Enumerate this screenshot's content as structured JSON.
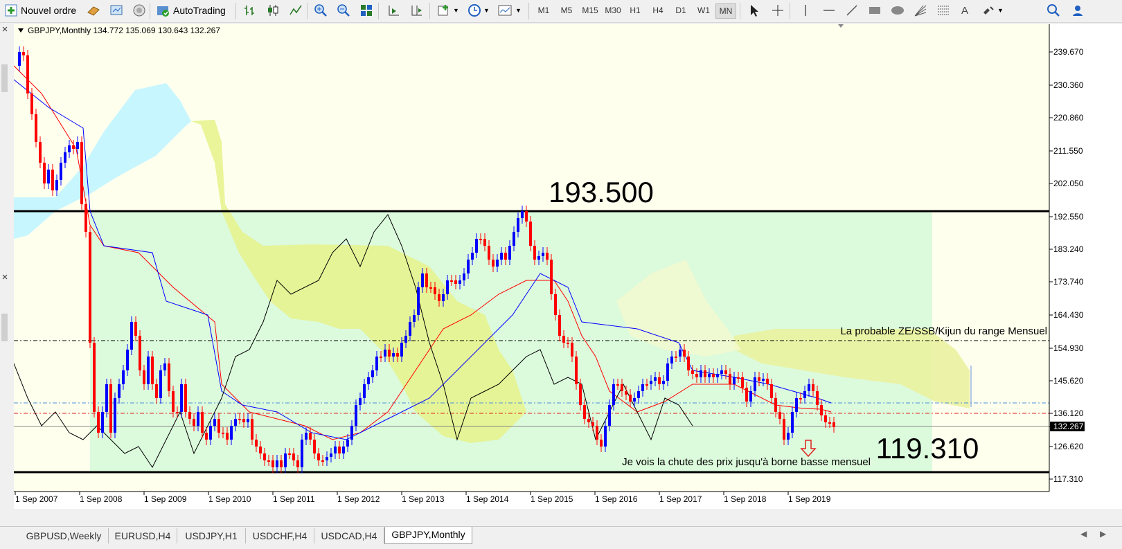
{
  "toolbar": {
    "new_order": "Nouvel ordre",
    "autotrading": "AutoTrading",
    "timeframes": [
      "M1",
      "M5",
      "M15",
      "M30",
      "H1",
      "H4",
      "D1",
      "W1",
      "MN"
    ],
    "active_timeframe": "MN"
  },
  "chart": {
    "header": "GBPJPY,Monthly  134.772 135.069 130.643 132.267",
    "price_labels": [
      "239.670",
      "230.360",
      "220.860",
      "211.550",
      "202.050",
      "192.550",
      "183.240",
      "173.740",
      "164.430",
      "154.930",
      "145.620",
      "136.120",
      "132.267",
      "126.620",
      "117.310"
    ],
    "current_price": "132.267",
    "date_labels": [
      "1 Sep 2007",
      "1 Sep 2008",
      "1 Sep 2009",
      "1 Sep 2010",
      "1 Sep 2011",
      "1 Sep 2012",
      "1 Sep 2013",
      "1 Sep 2014",
      "1 Sep 2015",
      "1 Sep 2016",
      "1 Sep 2017",
      "1 Sep 2018",
      "1 Sep 2019"
    ],
    "annotations": {
      "upper_level": "193.500",
      "lower_level": "119.310",
      "range_note": "La probable ZE/SSB/Kijun du range Mensuel",
      "fall_note": "Je vois la chute des prix jusqu'à borne basse mensuel"
    },
    "colors": {
      "background": "#ffffee",
      "range_box": "#dcfadc",
      "kumo_yellow": "#f2f2a0",
      "kumo_cyan": "#c8f6ff",
      "tenkan": "#ff0000",
      "kijun": "#0000ff",
      "chikou": "#000000",
      "bull": "#0000ff",
      "bear": "#ff0000"
    }
  },
  "tabs": [
    "GBPUSD,Weekly",
    "EURUSD,H4",
    "USDJPY,H1",
    "USDCHF,H4",
    "USDCAD,H4",
    "GBPJPY,Monthly"
  ],
  "active_tab": "GBPJPY,Monthly"
}
